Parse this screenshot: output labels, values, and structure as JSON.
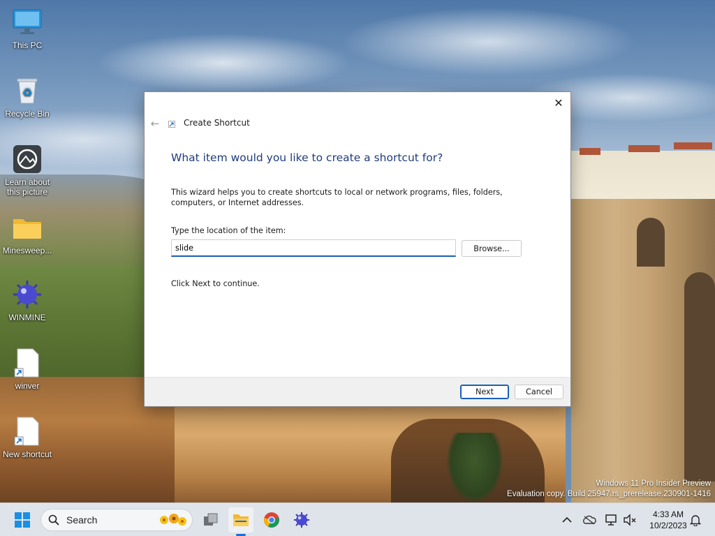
{
  "desktop": {
    "icons": [
      {
        "label": "This PC"
      },
      {
        "label": "Recycle Bin"
      },
      {
        "label": "Learn about this picture"
      },
      {
        "label": "Minesweep..."
      },
      {
        "label": "WINMINE"
      },
      {
        "label": "winver"
      },
      {
        "label": "New shortcut"
      }
    ]
  },
  "dialog": {
    "title": "Create Shortcut",
    "heading": "What item would you like to create a shortcut for?",
    "description": "This wizard helps you to create shortcuts to local or network programs, files, folders, computers, or Internet addresses.",
    "field_label": "Type the location of the item:",
    "location_value": "slide",
    "browse_label": "Browse...",
    "hint": "Click Next to continue.",
    "next_label": "Next",
    "cancel_label": "Cancel",
    "close_glyph": "✕",
    "back_glyph": "←"
  },
  "watermark": {
    "line1": "Windows 11 Pro Insider Preview",
    "line2": "Evaluation copy. Build 25947.rs_prerelease.230901-1416"
  },
  "taskbar": {
    "search_label": "Search",
    "time": "4:33 AM",
    "date": "10/2/2023",
    "icons": [
      "start-icon",
      "search-icon",
      "task-view-icon",
      "file-explorer-icon",
      "chrome-icon",
      "winmine-icon"
    ],
    "tray_icons": [
      "chevron-up-icon",
      "onedrive-icon",
      "network-icon",
      "volume-muted-icon",
      "notification-bell-icon"
    ]
  },
  "colors": {
    "accent": "#1a5fb4",
    "heading": "#1f3d7a",
    "taskbar_bg": "#dfe4ea"
  }
}
